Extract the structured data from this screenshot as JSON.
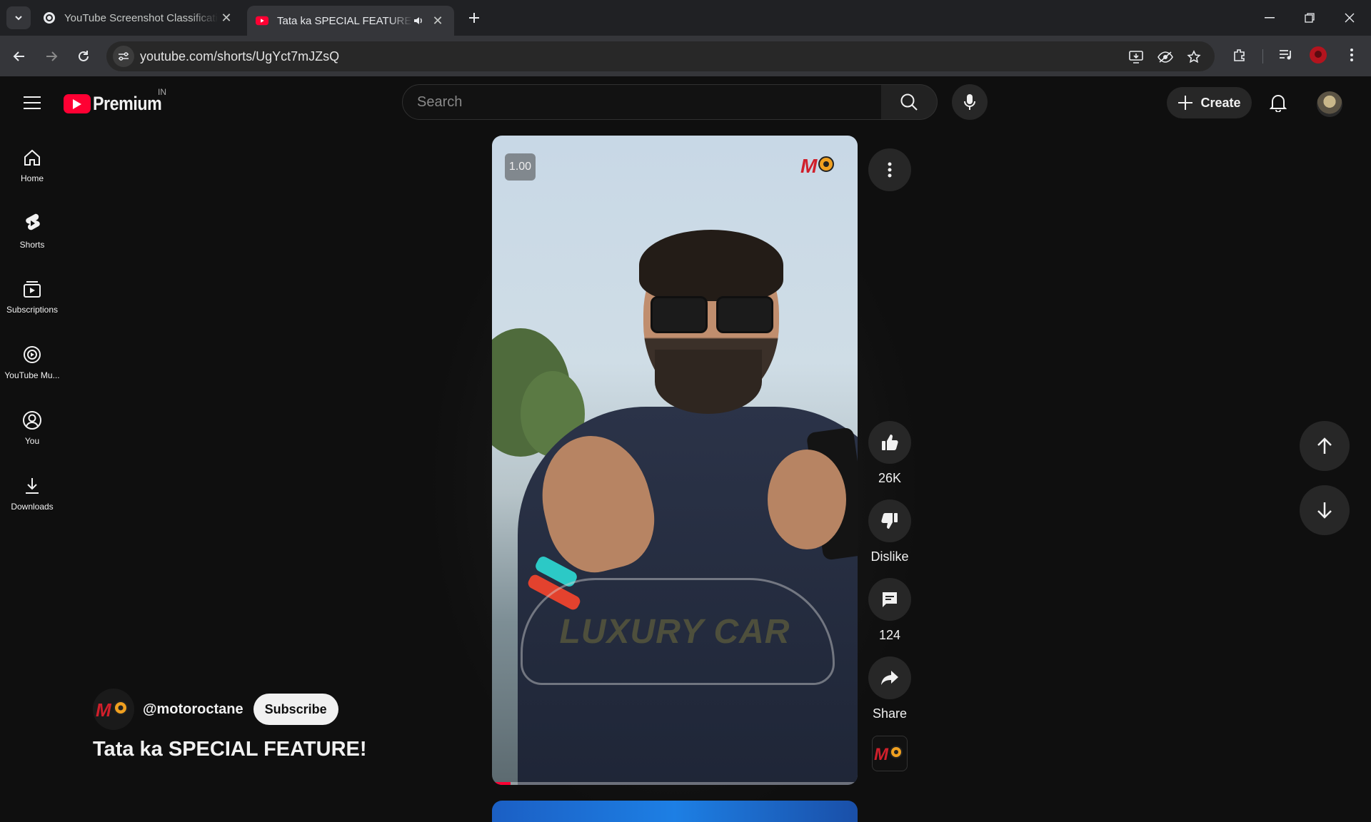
{
  "browser": {
    "tabs": [
      {
        "title": "YouTube Screenshot Classificati",
        "active": false
      },
      {
        "title": "Tata ka SPECIAL FEATURE! -",
        "active": true,
        "audio": true
      }
    ],
    "url": "youtube.com/shorts/UgYct7mJZsQ"
  },
  "masthead": {
    "brand": "Premium",
    "country_code": "IN",
    "search_placeholder": "Search",
    "create_label": "Create"
  },
  "guide": {
    "items": [
      {
        "label": "Home",
        "icon": "home-icon"
      },
      {
        "label": "Shorts",
        "icon": "shorts-icon"
      },
      {
        "label": "Subscriptions",
        "icon": "subscriptions-icon"
      },
      {
        "label": "YouTube Mu...",
        "icon": "youtube-music-icon"
      },
      {
        "label": "You",
        "icon": "you-icon"
      },
      {
        "label": "Downloads",
        "icon": "downloads-icon"
      }
    ]
  },
  "short": {
    "playback_speed": "1.00",
    "overlay_text": "LUXURY CAR",
    "channel_handle": "@motoroctane",
    "subscribe_label": "Subscribe",
    "title": "Tata ka SPECIAL FEATURE!",
    "progress_fraction": 0.05,
    "actions": {
      "like_count": "26K",
      "dislike_label": "Dislike",
      "comment_count": "124",
      "share_label": "Share"
    }
  },
  "colors": {
    "background": "#0f0f0f",
    "brand_red": "#ff0033",
    "button_dark": "#272727",
    "chrome_tabbar": "#202124",
    "chrome_toolbar": "#35363a"
  }
}
